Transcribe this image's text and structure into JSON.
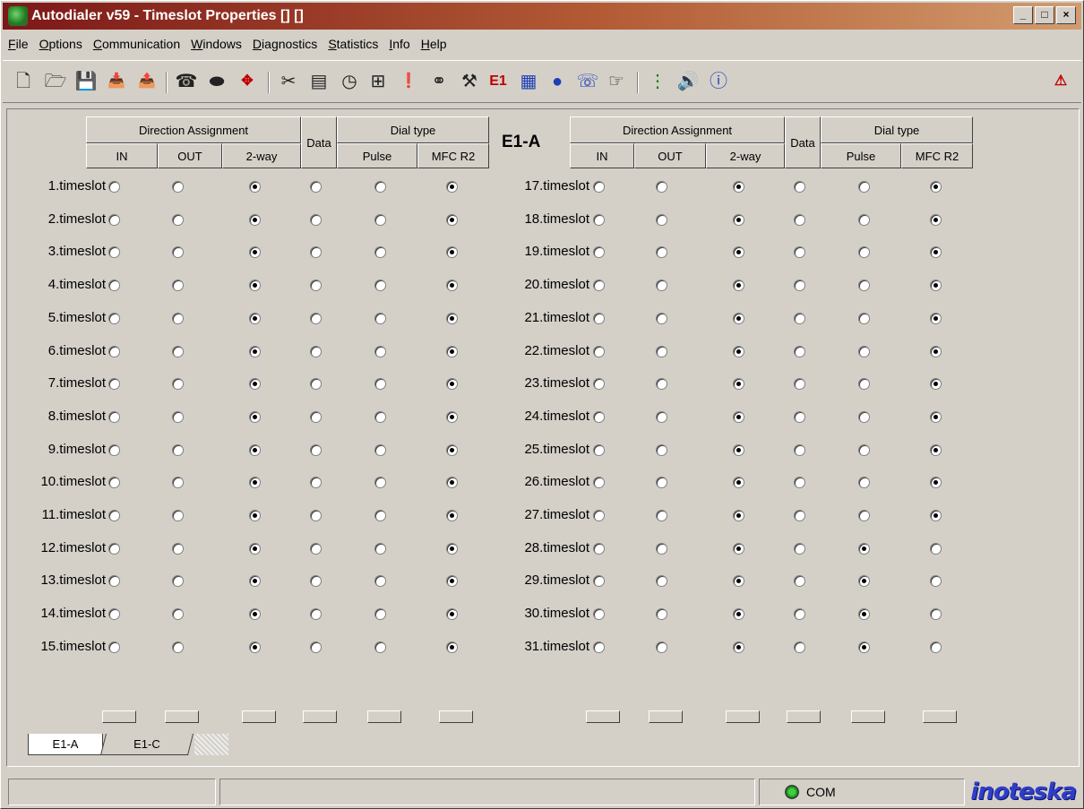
{
  "window": {
    "title": "Autodialer v59 - Timeslot Properties [] []",
    "controls": [
      "_",
      "□",
      "×"
    ]
  },
  "menu": [
    "File",
    "Options",
    "Communication",
    "Windows",
    "Diagnostics",
    "Statistics",
    "Info",
    "Help"
  ],
  "toolbar": {
    "icons": [
      {
        "name": "new-file-icon",
        "glyph": "🗋"
      },
      {
        "name": "open-folder-icon",
        "glyph": "🗁"
      },
      {
        "name": "save-icon",
        "glyph": "💾"
      },
      {
        "name": "import-icon",
        "glyph": "📥"
      },
      {
        "name": "export-icon",
        "glyph": "📤"
      },
      {
        "name": "phone-icon",
        "glyph": "☎"
      },
      {
        "name": "chip-icon",
        "glyph": "⬬"
      },
      {
        "name": "move-arrows-icon",
        "glyph": "✥"
      },
      {
        "name": "scissors-icon",
        "glyph": "✂"
      },
      {
        "name": "terminal-icon",
        "glyph": "▤"
      },
      {
        "name": "clock-icon",
        "glyph": "◷"
      },
      {
        "name": "grid-icon",
        "glyph": "⊞"
      },
      {
        "name": "alert-document-icon",
        "glyph": "❗"
      },
      {
        "name": "link-icon",
        "glyph": "⚭"
      },
      {
        "name": "tools-icon",
        "glyph": "⚒"
      },
      {
        "name": "e1-icon",
        "glyph": "E1"
      },
      {
        "name": "calendar-icon",
        "glyph": "▦"
      },
      {
        "name": "globe-icon",
        "glyph": "●"
      },
      {
        "name": "cli-phone-icon",
        "glyph": "☏"
      },
      {
        "name": "pointer-icon",
        "glyph": "☞"
      },
      {
        "name": "traffic-light-icon",
        "glyph": "⋮"
      },
      {
        "name": "speaker-icon",
        "glyph": "🔊"
      },
      {
        "name": "info-icon",
        "glyph": "ⓘ"
      },
      {
        "name": "help-book-icon",
        "glyph": "⚠"
      }
    ]
  },
  "panel": {
    "title": "E1-A",
    "headers": {
      "direction": "Direction Assignment",
      "data": "Data",
      "dial": "Dial type",
      "in": "IN",
      "out": "OUT",
      "twoway": "2-way",
      "pulse": "Pulse",
      "mfc": "MFC R2"
    },
    "left_rows": [
      {
        "label": "1.timeslot",
        "direction": "2-way",
        "data": false,
        "dial": "MFC R2"
      },
      {
        "label": "2.timeslot",
        "direction": "2-way",
        "data": false,
        "dial": "MFC R2"
      },
      {
        "label": "3.timeslot",
        "direction": "2-way",
        "data": false,
        "dial": "MFC R2"
      },
      {
        "label": "4.timeslot",
        "direction": "2-way",
        "data": false,
        "dial": "MFC R2"
      },
      {
        "label": "5.timeslot",
        "direction": "2-way",
        "data": false,
        "dial": "MFC R2"
      },
      {
        "label": "6.timeslot",
        "direction": "2-way",
        "data": false,
        "dial": "MFC R2"
      },
      {
        "label": "7.timeslot",
        "direction": "2-way",
        "data": false,
        "dial": "MFC R2"
      },
      {
        "label": "8.timeslot",
        "direction": "2-way",
        "data": false,
        "dial": "MFC R2"
      },
      {
        "label": "9.timeslot",
        "direction": "2-way",
        "data": false,
        "dial": "MFC R2"
      },
      {
        "label": "10.timeslot",
        "direction": "2-way",
        "data": false,
        "dial": "MFC R2"
      },
      {
        "label": "11.timeslot",
        "direction": "2-way",
        "data": false,
        "dial": "MFC R2"
      },
      {
        "label": "12.timeslot",
        "direction": "2-way",
        "data": false,
        "dial": "MFC R2"
      },
      {
        "label": "13.timeslot",
        "direction": "2-way",
        "data": false,
        "dial": "MFC R2"
      },
      {
        "label": "14.timeslot",
        "direction": "2-way",
        "data": false,
        "dial": "MFC R2"
      },
      {
        "label": "15.timeslot",
        "direction": "2-way",
        "data": false,
        "dial": "MFC R2"
      }
    ],
    "right_rows": [
      {
        "label": "17.timeslot",
        "direction": "2-way",
        "data": false,
        "dial": "MFC R2"
      },
      {
        "label": "18.timeslot",
        "direction": "2-way",
        "data": false,
        "dial": "MFC R2"
      },
      {
        "label": "19.timeslot",
        "direction": "2-way",
        "data": false,
        "dial": "MFC R2"
      },
      {
        "label": "20.timeslot",
        "direction": "2-way",
        "data": false,
        "dial": "MFC R2"
      },
      {
        "label": "21.timeslot",
        "direction": "2-way",
        "data": false,
        "dial": "MFC R2"
      },
      {
        "label": "22.timeslot",
        "direction": "2-way",
        "data": false,
        "dial": "MFC R2"
      },
      {
        "label": "23.timeslot",
        "direction": "2-way",
        "data": false,
        "dial": "MFC R2"
      },
      {
        "label": "24.timeslot",
        "direction": "2-way",
        "data": false,
        "dial": "MFC R2"
      },
      {
        "label": "25.timeslot",
        "direction": "2-way",
        "data": false,
        "dial": "MFC R2"
      },
      {
        "label": "26.timeslot",
        "direction": "2-way",
        "data": false,
        "dial": "MFC R2"
      },
      {
        "label": "27.timeslot",
        "direction": "2-way",
        "data": false,
        "dial": "MFC R2"
      },
      {
        "label": "28.timeslot",
        "direction": "2-way",
        "data": false,
        "dial": "Pulse"
      },
      {
        "label": "29.timeslot",
        "direction": "2-way",
        "data": false,
        "dial": "Pulse"
      },
      {
        "label": "30.timeslot",
        "direction": "2-way",
        "data": false,
        "dial": "Pulse"
      },
      {
        "label": "31.timeslot",
        "direction": "2-way",
        "data": false,
        "dial": "Pulse"
      }
    ]
  },
  "tabs": [
    {
      "label": "E1-A",
      "active": true
    },
    {
      "label": "E1-C",
      "active": false
    }
  ],
  "status": {
    "com_label": "COM",
    "brand": "inoteska"
  },
  "colors": {
    "face": "#d4d0c8",
    "title_start": "#7c1818",
    "title_end": "#d29c6e",
    "brand": "#2f3ec8"
  }
}
